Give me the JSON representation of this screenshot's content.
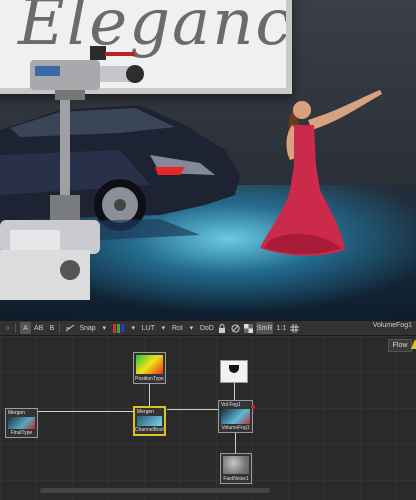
{
  "viewer": {
    "sign_text": "Elegance",
    "name": "VolumeFog1"
  },
  "toolbar": {
    "circle_label": "○",
    "a_label": "A",
    "ab_label": "AB",
    "b_label": "B",
    "snap_label": "Snap",
    "lut_label": "LUT",
    "roi_label": "RoI",
    "dod_label": "DoD",
    "smr_label": "SmR",
    "ratio_label": "1:1"
  },
  "flow": {
    "tab_label": "Flow",
    "accent_color": "#e0c020",
    "nodes": {
      "positiontype": {
        "label": "PositionType"
      },
      "channelbool": {
        "label": "ChannelBool1",
        "title": "Mergen"
      },
      "volumefog": {
        "label": "VolumeFog1",
        "title": "Vol.Fog1"
      },
      "finaltype": {
        "label": "FinalType",
        "title": "Mergen"
      },
      "fastnoise": {
        "label": "FastNoise1"
      },
      "mask": {
        "label": ""
      }
    }
  }
}
